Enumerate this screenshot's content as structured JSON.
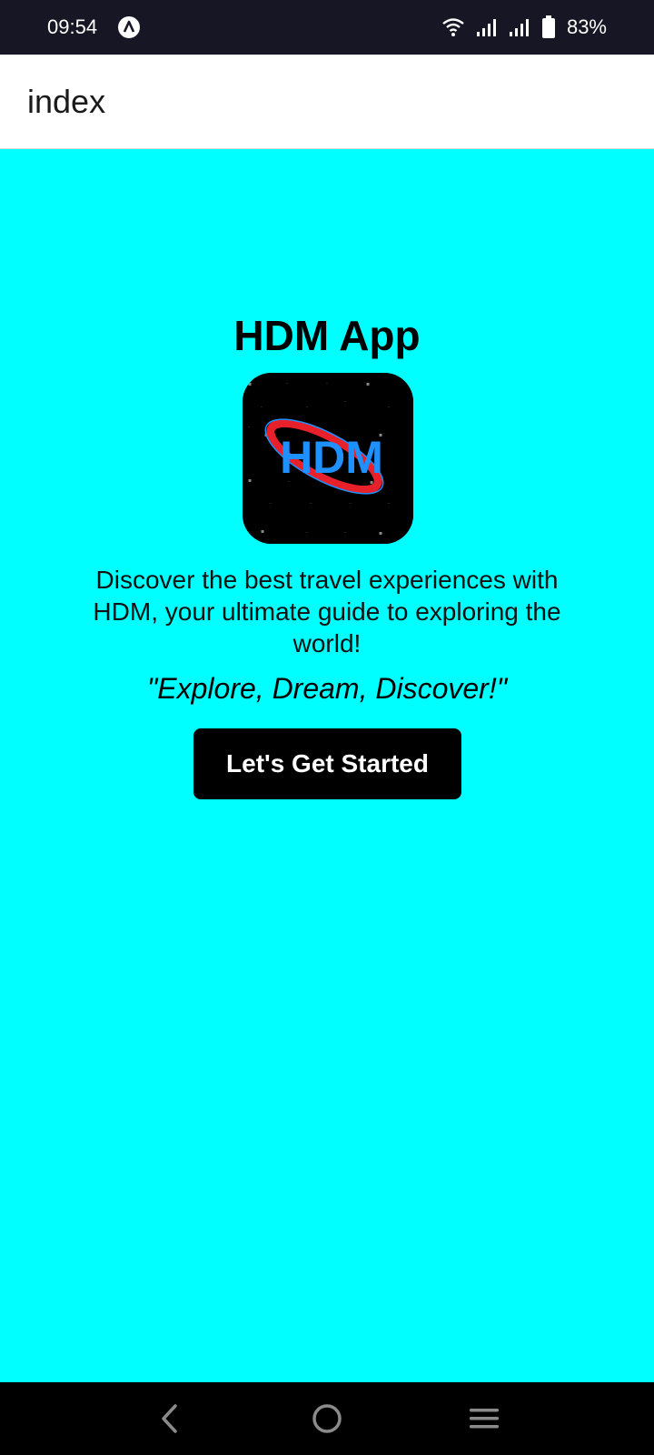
{
  "status_bar": {
    "time": "09:54",
    "battery": "83%",
    "icons": [
      "notification-app-icon",
      "wifi-icon",
      "signal-icon",
      "signal-icon",
      "battery-icon"
    ]
  },
  "header": {
    "title": "index"
  },
  "main": {
    "app_title": "HDM App",
    "logo_text": "HDM",
    "description": "Discover the best travel experiences with HDM, your ultimate guide to exploring the world!",
    "tagline": "\"Explore, Dream, Discover!\"",
    "cta_label": "Let's Get Started"
  },
  "nav_bar": {
    "icons": [
      "back-icon",
      "home-icon",
      "menu-icon"
    ]
  },
  "colors": {
    "background": "#00ffff",
    "status_bar": "#171624",
    "button": "#000000",
    "logo_blue": "#1e90ff",
    "logo_red": "#e8202a"
  }
}
